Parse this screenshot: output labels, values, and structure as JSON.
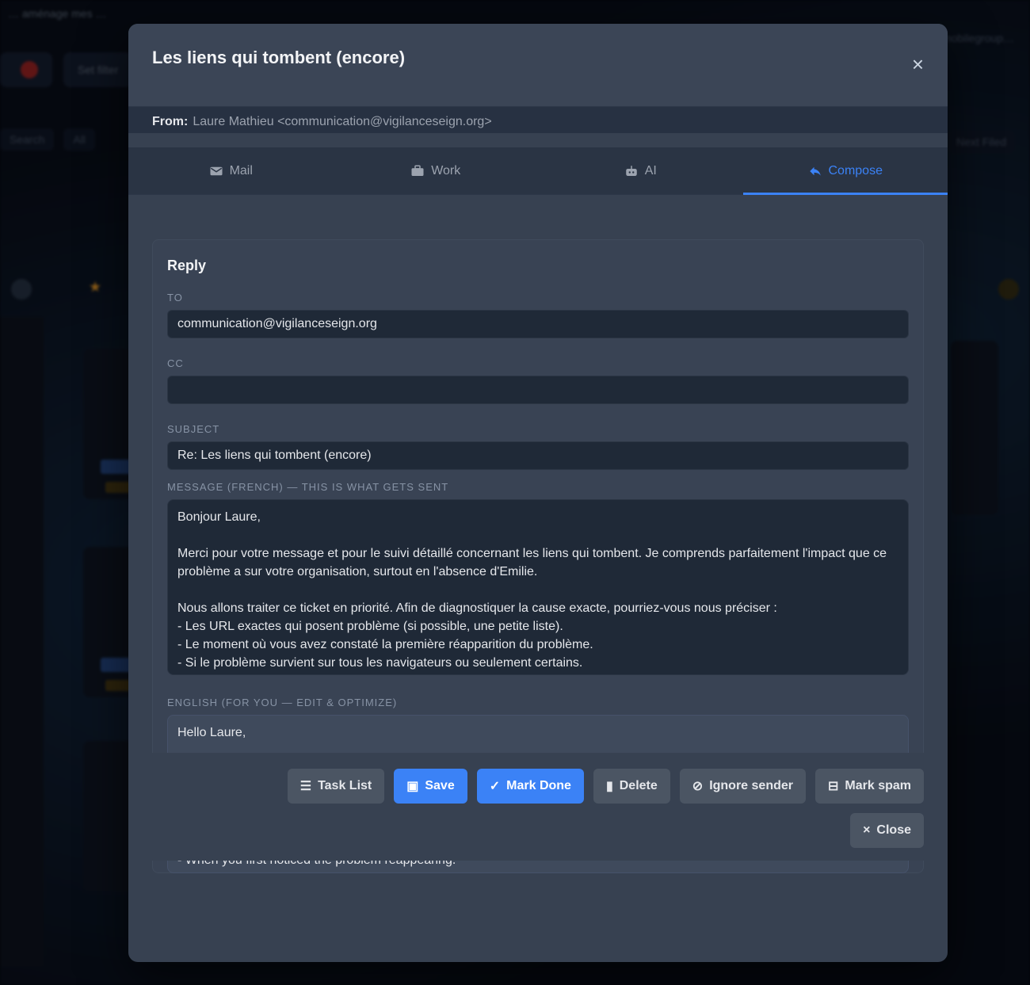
{
  "background": {
    "top_text": "… aménage mes …",
    "toolbar_chip_1": "",
    "toolbar_chip_2": "Set filter",
    "filter_1": "Search",
    "filter_2": "All",
    "right_text": "…main@mobilegroup…",
    "right_chip": "Next Filed"
  },
  "modal": {
    "title": "Les liens qui tombent (encore)",
    "close_glyph": "×",
    "from_label": "From:",
    "from_value": "Laure Mathieu <communication@vigilanceseign.org>"
  },
  "tabs": [
    {
      "label": "Mail",
      "icon": "mail-icon"
    },
    {
      "label": "Work",
      "icon": "briefcase-icon"
    },
    {
      "label": "AI",
      "icon": "robot-icon"
    },
    {
      "label": "Compose",
      "icon": "reply-icon",
      "active": true
    }
  ],
  "compose": {
    "heading": "Reply",
    "to_label": "TO",
    "to_value": "communication@vigilanceseign.org",
    "cc_label": "CC",
    "cc_value": "",
    "subject_label": "SUBJECT",
    "subject_value": "Re: Les liens qui tombent (encore)",
    "message_label": "MESSAGE (FRENCH) — THIS IS WHAT GETS SENT",
    "message_value": "Bonjour Laure,\n\nMerci pour votre message et pour le suivi détaillé concernant les liens qui tombent. Je comprends parfaitement l'impact que ce problème a sur votre organisation, surtout en l'absence d'Emilie.\n\nNous allons traiter ce ticket en priorité. Afin de diagnostiquer la cause exacte, pourriez-vous nous préciser :\n- Les URL exactes qui posent problème (si possible, une petite liste).\n- Le moment où vous avez constaté la première réapparition du problème.\n- Si le problème survient sur tous les navigateurs ou seulement certains.",
    "english_label": "ENGLISH (FOR YOU — EDIT & OPTIMIZE)",
    "english_value": "Hello Laure,\n\nThank you for your message and for the detailed follow-up regarding the broken links. I fully understand the impact this issue has on your organization, especially in Emilie's absence.\n\nWe will treat this ticket as a priority. In order to diagnose the exact cause, could you please specify:\n- The exact URLs that are causing the problem (if possible, a short list).\n- When you first noticed the problem reappearing."
  },
  "footer": {
    "task_list": "Task List",
    "save": "Save",
    "mark_done": "Mark Done",
    "delete": "Delete",
    "ignore_sender": "Ignore sender",
    "mark_spam": "Mark spam",
    "close": "Close"
  },
  "colors": {
    "accent": "#3b82f6",
    "modal_bg": "#374151",
    "input_bg": "#1f2937"
  }
}
